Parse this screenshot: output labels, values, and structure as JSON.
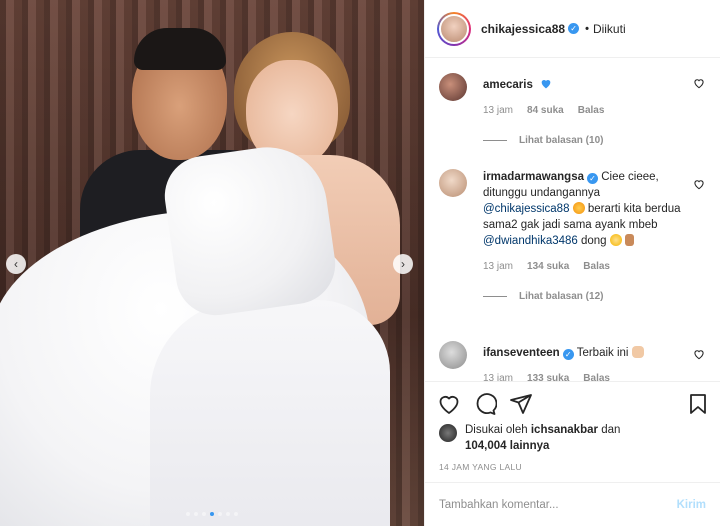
{
  "header": {
    "username": "chikajessica88",
    "separator": "•",
    "follow_status": "Diikuti"
  },
  "media": {
    "prev_glyph": "‹",
    "next_glyph": "›",
    "carousel": {
      "count": 7,
      "active_index": 3
    }
  },
  "comments": [
    {
      "username": "amecaris",
      "text_emoji": "blue-heart",
      "time": "13 jam",
      "likes": "84 suka",
      "reply": "Balas",
      "view_replies": "Lihat balasan (10)"
    },
    {
      "username": "irmadarmawangsa",
      "verified": true,
      "text_1": "Ciee cieee, ditunggu undangannya",
      "mention_1": "@chikajessica88",
      "text_2": "berarti kita berdua sama2 gak jadi sama ayank mbeb",
      "mention_2": "@dwiandhika3486",
      "text_3": "dong",
      "time": "13 jam",
      "likes": "134 suka",
      "reply": "Balas",
      "view_replies": "Lihat balasan (12)"
    },
    {
      "username": "ifanseventeen",
      "verified": true,
      "text": "Terbaik ini",
      "time": "13 jam",
      "likes": "133 suka",
      "reply": "Balas"
    }
  ],
  "likes": {
    "prefix": "Disukai oleh",
    "user": "ichsanakbar",
    "joiner": "dan",
    "others": "104,004 lainnya"
  },
  "date": "14 JAM YANG LALU",
  "add_comment": {
    "placeholder": "Tambahkan komentar...",
    "post_label": "Kirim"
  },
  "colors": {
    "accent": "#3897f0",
    "post_disabled": "#b2dffc",
    "muted": "#8e8e8e",
    "mention": "#00376b"
  }
}
